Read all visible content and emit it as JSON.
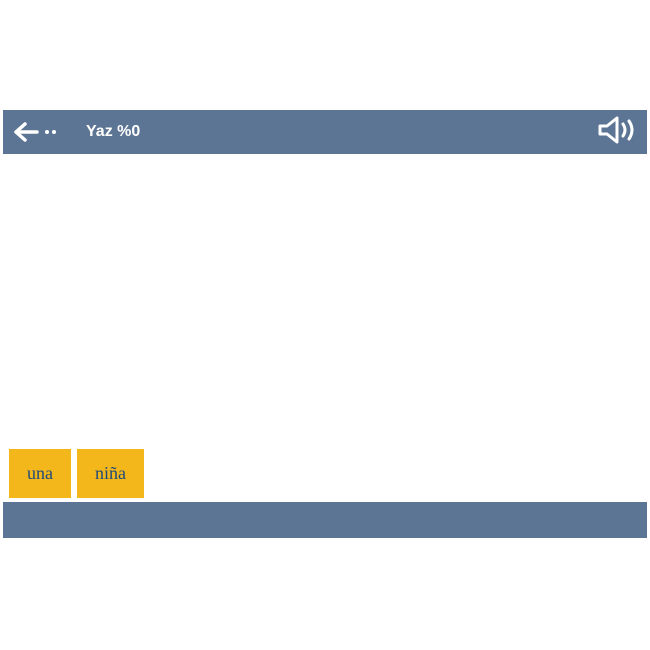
{
  "header": {
    "title": "Yaz %0"
  },
  "words": {
    "item0": "una",
    "item1": "niña"
  },
  "colors": {
    "header_bg": "#5d7594",
    "chip_bg": "#f3b71b",
    "chip_text": "#1e4a7a"
  }
}
